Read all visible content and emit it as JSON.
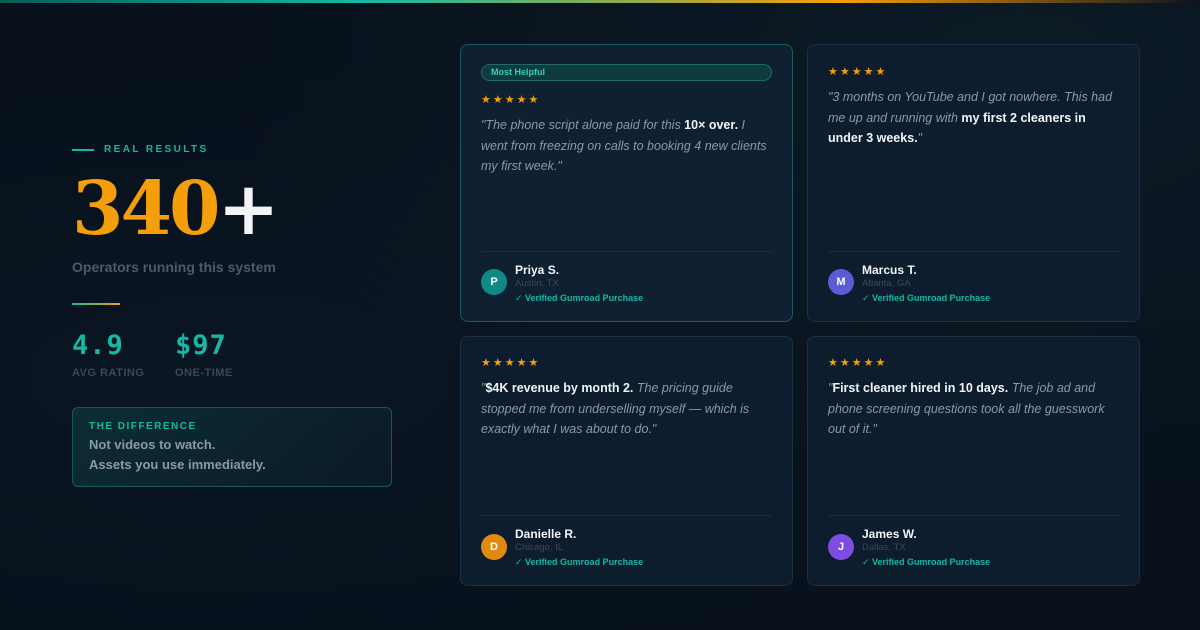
{
  "hero": {
    "eyebrow": "REAL RESULTS",
    "big_number": "340",
    "big_plus": "+",
    "subtitle": "Operators running this system"
  },
  "stats": [
    {
      "value": "4.9",
      "label": "AVG RATING"
    },
    {
      "value": "$97",
      "label": "ONE-TIME"
    }
  ],
  "difference": {
    "title": "THE DIFFERENCE",
    "line1": "Not videos to watch.",
    "line2": "Assets you use immediately."
  },
  "testimonials": [
    {
      "badge": "Most Helpful",
      "stars": "★★★★★",
      "quote_pre": "\"The phone script alone paid for this ",
      "quote_bold": "10× over.",
      "quote_post": " I went from freezing on calls to booking 4 new clients my first week.\"",
      "initial": "P",
      "avatar_color": "#0f8a84",
      "name": "Priya S.",
      "location": "Austin, TX",
      "verified": "✓ Verified Gumroad Purchase"
    },
    {
      "stars": "★★★★★",
      "quote_pre": "\"3 months on YouTube and I got nowhere. This had me up and running with ",
      "quote_bold": "my first 2 cleaners in under 3 weeks.",
      "quote_post": "\"",
      "initial": "M",
      "avatar_color": "#5b5bd6",
      "name": "Marcus T.",
      "location": "Atlanta, GA",
      "verified": "✓ Verified Gumroad Purchase"
    },
    {
      "stars": "★★★★★",
      "quote_pre": "\"",
      "quote_bold": "$4K revenue by month 2.",
      "quote_post": " The pricing guide stopped me from underselling myself — which is exactly what I was about to do.\"",
      "initial": "D",
      "avatar_color": "#e08a0c",
      "name": "Danielle R.",
      "location": "Chicago, IL",
      "verified": "✓ Verified Gumroad Purchase"
    },
    {
      "stars": "★★★★★",
      "quote_pre": "\"",
      "quote_bold": "First cleaner hired in 10 days.",
      "quote_post": " The job ad and phone screening questions took all the guesswork out of it.\"",
      "initial": "J",
      "avatar_color": "#7c4de0",
      "name": "James W.",
      "location": "Dallas, TX",
      "verified": "✓ Verified Gumroad Purchase"
    }
  ],
  "colors": {
    "accent_teal": "#14b8a6",
    "accent_amber": "#f59e0b",
    "background": "#08111c",
    "card": "#0e1d2d"
  }
}
